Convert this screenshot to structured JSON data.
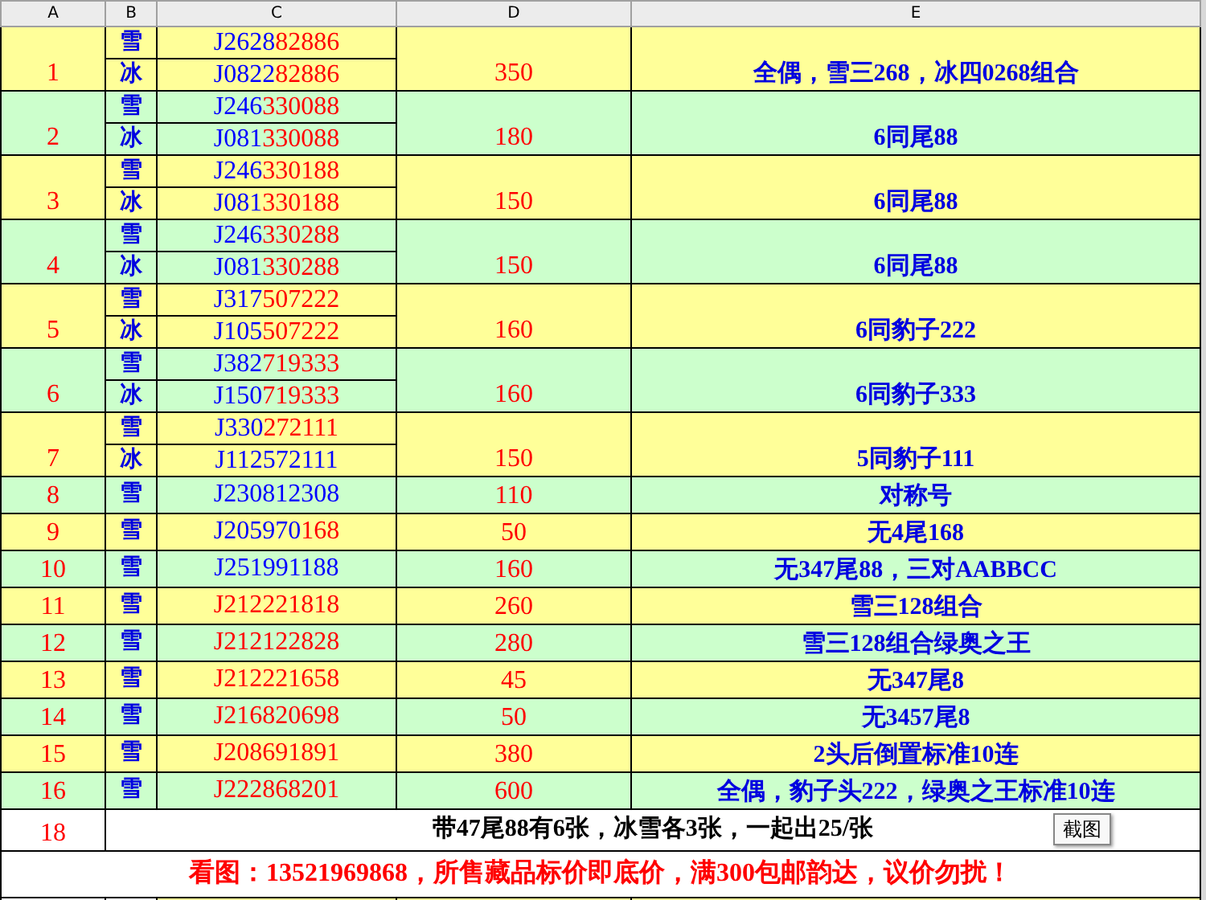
{
  "columns": [
    "A",
    "B",
    "C",
    "D",
    "E"
  ],
  "rows": [
    {
      "number": "1",
      "color": "#ffff99",
      "tickets": [
        {
          "label": "雪",
          "head": "J2628",
          "tail": "82886"
        },
        {
          "label": "冰",
          "head": "J0822",
          "tail": "82886"
        }
      ],
      "price": "350",
      "note": "全偶，雪三268，冰四0268组合"
    },
    {
      "number": "2",
      "color": "#ccffcc",
      "tickets": [
        {
          "label": "雪",
          "head": "J246",
          "tail": "330088"
        },
        {
          "label": "冰",
          "head": "J081",
          "tail": "330088"
        }
      ],
      "price": "180",
      "note": "6同尾88"
    },
    {
      "number": "3",
      "color": "#ffff99",
      "tickets": [
        {
          "label": "雪",
          "head": "J246",
          "tail": "330188"
        },
        {
          "label": "冰",
          "head": "J081",
          "tail": "330188"
        }
      ],
      "price": "150",
      "note": "6同尾88"
    },
    {
      "number": "4",
      "color": "#ccffcc",
      "tickets": [
        {
          "label": "雪",
          "head": "J246",
          "tail": "330288"
        },
        {
          "label": "冰",
          "head": "J081",
          "tail": "330288"
        }
      ],
      "price": "150",
      "note": "6同尾88"
    },
    {
      "number": "5",
      "color": "#ffff99",
      "tickets": [
        {
          "label": "雪",
          "head": "J317",
          "tail": "507222"
        },
        {
          "label": "冰",
          "head": "J105",
          "tail": "507222"
        }
      ],
      "price": "160",
      "note": "6同豹子222"
    },
    {
      "number": "6",
      "color": "#ccffcc",
      "tickets": [
        {
          "label": "雪",
          "head": "J382",
          "tail": "719333"
        },
        {
          "label": "冰",
          "head": "J150",
          "tail": "719333"
        }
      ],
      "price": "160",
      "note": "6同豹子333"
    },
    {
      "number": "7",
      "color": "#ffff99",
      "tickets": [
        {
          "label": "雪",
          "head": "J330",
          "tail": "272111"
        },
        {
          "label": "冰",
          "head": "J112572111"
        }
      ],
      "price": "150",
      "note": "5同豹子111"
    },
    {
      "number": "8",
      "color": "#ccffcc",
      "tickets": [
        {
          "label": "雪",
          "head": "J230812308"
        }
      ],
      "price": "110",
      "note": "对称号"
    },
    {
      "number": "9",
      "color": "#ffff99",
      "tickets": [
        {
          "label": "雪",
          "head": "J205970",
          "tail": "168"
        }
      ],
      "price": "50",
      "note": "无4尾168"
    },
    {
      "number": "10",
      "color": "#ccffcc",
      "tickets": [
        {
          "label": "雪",
          "head": "J251991188"
        }
      ],
      "price": "160",
      "note": "无347尾88，三对AABBCC"
    },
    {
      "number": "11",
      "color": "#ffff99",
      "tickets": [
        {
          "label": "雪",
          "tail": "J212221818"
        }
      ],
      "price": "260",
      "note": "雪三128组合"
    },
    {
      "number": "12",
      "color": "#ccffcc",
      "tickets": [
        {
          "label": "雪",
          "tail": "J212122828"
        }
      ],
      "price": "280",
      "note": "雪三128组合绿奥之王"
    },
    {
      "number": "13",
      "color": "#ffff99",
      "tickets": [
        {
          "label": "雪",
          "tail": "J212221658"
        }
      ],
      "price": "45",
      "note": "无347尾8"
    },
    {
      "number": "14",
      "color": "#ccffcc",
      "tickets": [
        {
          "label": "雪",
          "tail": "J216820698"
        }
      ],
      "price": "50",
      "note": "无3457尾8"
    },
    {
      "number": "15",
      "color": "#ffff99",
      "tickets": [
        {
          "label": "雪",
          "tail": "J208691891"
        }
      ],
      "price": "380",
      "note": "2头后倒置标准10连"
    },
    {
      "number": "16",
      "color": "#ccffcc",
      "tickets": [
        {
          "label": "雪",
          "tail": "J222868201"
        }
      ],
      "price": "600",
      "note": "全偶，豹子头222，绿奥之王标准10连"
    }
  ],
  "summary_row": {
    "number": "18",
    "text": "带47尾88有6张，冰雪各3张，一起出25/张"
  },
  "footer": "看图：13521969868，所售藏品标价即底价，满300包邮韵达，议价勿扰！",
  "tooltip": "截图"
}
